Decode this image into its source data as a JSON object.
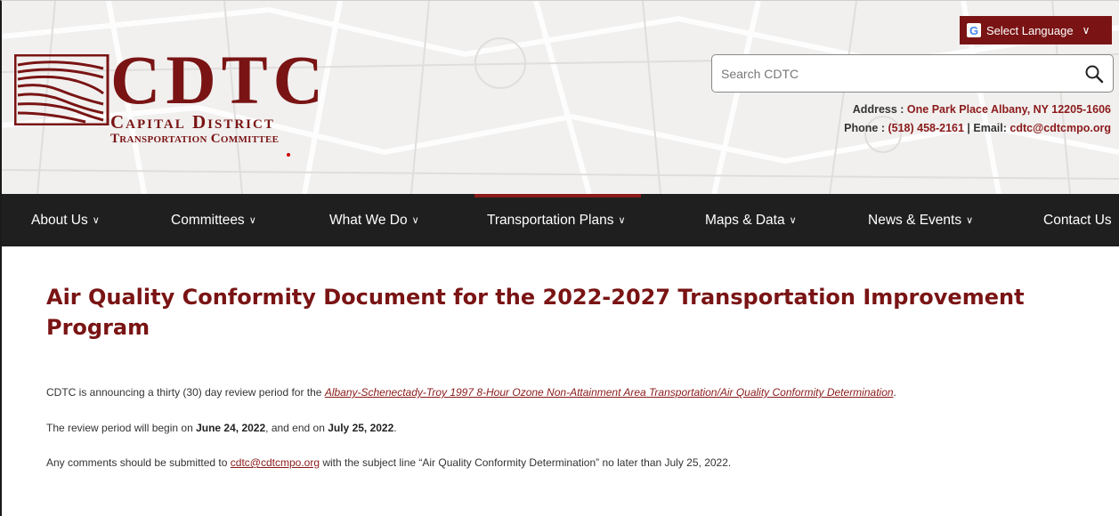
{
  "header": {
    "logo": {
      "letters": "CDTC",
      "line1": "Capital District",
      "line2": "Transportation Committee"
    },
    "language_button": {
      "label": "Select Language",
      "icon": "google-icon",
      "chevron": "chevron-down-icon"
    },
    "search": {
      "placeholder": "Search CDTC",
      "value": "",
      "icon": "search-icon"
    },
    "address_label": "Address : ",
    "address_value": "One Park Place Albany, NY 12205-1606",
    "phone_label": "Phone : ",
    "phone_value": "(518) 458-2161",
    "separator": " | ",
    "email_label": "Email: ",
    "email_value": "cdtc@cdtcmpo.org"
  },
  "nav": {
    "items": [
      {
        "label": "About Us"
      },
      {
        "label": "Committees"
      },
      {
        "label": "What We Do"
      },
      {
        "label": "Transportation Plans"
      },
      {
        "label": "Maps & Data"
      },
      {
        "label": "News & Events"
      },
      {
        "label": "Contact Us"
      }
    ],
    "active_index": 3
  },
  "main": {
    "title": "Air Quality Conformity Document for the 2022-2027 Transportation Improvement Program",
    "p1_text": "CDTC is announcing a thirty (30) day review period for the ",
    "p1_link": "Albany-Schenectady-Troy 1997 8-Hour Ozone Non-Attainment Area Transportation/Air Quality Conformity Determination",
    "p1_end": ".",
    "p2_a": "The review period will begin on ",
    "p2_date1": "June 24, 2022",
    "p2_b": ", and end on ",
    "p2_date2": "July 25, 2022",
    "p2_c": ".",
    "p3_a": "Any comments should be submitted to ",
    "p3_link": "cdtc@cdtcmpo.org",
    "p3_b": " with the subject line “Air Quality Conformity Determination” no later than July 25, 2022."
  },
  "colors": {
    "brand_red": "#7a1414",
    "nav_bg": "#1f1f1f",
    "header_bg": "#f1f0ef"
  }
}
